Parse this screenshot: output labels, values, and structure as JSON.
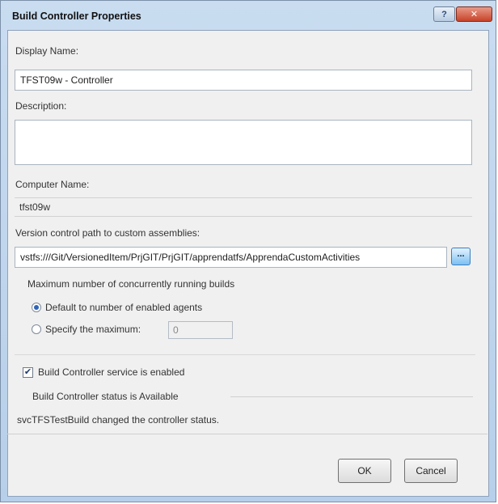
{
  "window": {
    "title": "Build Controller Properties",
    "help_label": "?",
    "close_label": "✕"
  },
  "form": {
    "display_name_label": "Display Name:",
    "display_name_value": "TFST09w - Controller",
    "description_label": "Description:",
    "description_value": "",
    "computer_name_label": "Computer Name:",
    "computer_name_value": "tfst09w",
    "vc_path_label": "Version control path to custom assemblies:",
    "vc_path_value": "vstfs:///Git/VersionedItem/PrjGIT/PrjGIT/apprendatfs/ApprendaCustomActivities",
    "browse_label": "...",
    "max_builds_title": "Maximum number of concurrently running builds",
    "radio_default_label": "Default to number of enabled agents",
    "radio_specify_label": "Specify the maximum:",
    "max_value": "0",
    "service_enabled_label": "Build Controller service is enabled",
    "service_enabled_checked": true,
    "status_text": "Build Controller status is Available",
    "changed_by_text": "svcTFSTestBuild changed the controller status."
  },
  "buttons": {
    "ok": "OK",
    "cancel": "Cancel"
  },
  "colors": {
    "title_bar": "#c9dcf0",
    "close_button": "#c7432a",
    "client_bg": "#f0f0f0",
    "accent": "#2e64b8"
  }
}
